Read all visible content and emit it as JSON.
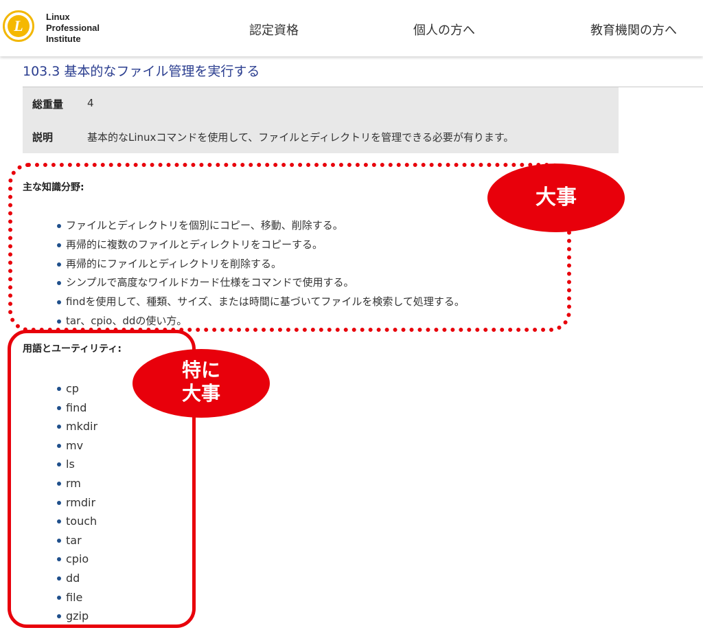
{
  "header": {
    "logo_letter": "L",
    "logo_lines": [
      "Linux",
      "Professional",
      "Institute"
    ],
    "nav": [
      {
        "label": "認定資格"
      },
      {
        "label": "個人の方へ"
      },
      {
        "label": "教育機関の方へ"
      }
    ]
  },
  "section": {
    "title": "103.3 基本的なファイル管理を実行する",
    "info": [
      {
        "label": "総重量",
        "value": "4"
      },
      {
        "label": "説明",
        "value": "基本的なLinuxコマンドを使用して、ファイルとディレクトリを管理できる必要が有ります。"
      }
    ]
  },
  "knowledge_areas": {
    "heading": "主な知識分野:",
    "items": [
      "ファイルとディレクトリを個別にコピー、移動、削除する。",
      "再帰的に複数のファイルとディレクトリをコピーする。",
      "再帰的にファイルとディレクトリを削除する。",
      "シンプルで高度なワイルドカード仕様をコマンドで使用する。",
      "findを使用して、種類、サイズ、または時間に基づいてファイルを検索して処理する。",
      "tar、cpio、ddの使い方。"
    ]
  },
  "terms": {
    "heading": "用語とユーティリティ:",
    "items": [
      "cp",
      "find",
      "mkdir",
      "mv",
      "ls",
      "rm",
      "rmdir",
      "touch",
      "tar",
      "cpio",
      "dd",
      "file",
      "gzip"
    ]
  },
  "annotations": {
    "callout_1": "大事",
    "callout_2_lines": [
      "特に",
      "大事"
    ],
    "color": "#e8000b"
  },
  "colors": {
    "title": "#2a3d8f",
    "logo": "#f5b800",
    "bullet": "#1f4f8b"
  }
}
